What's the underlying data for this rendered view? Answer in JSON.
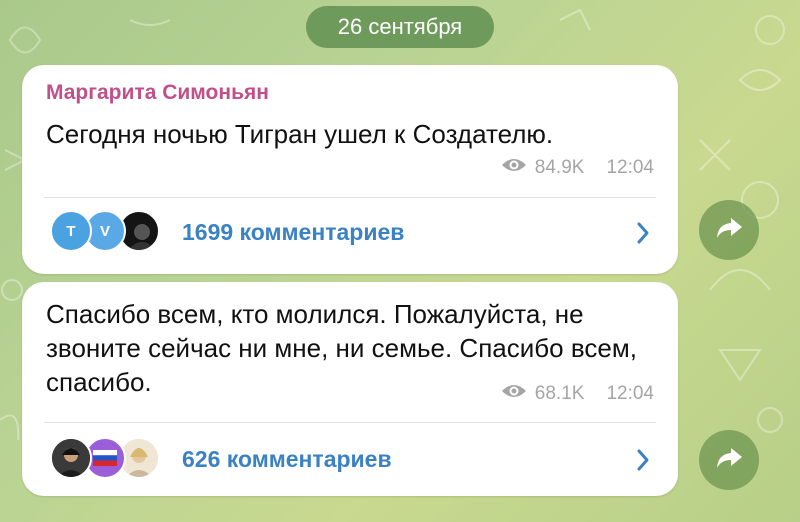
{
  "date_label": "26 сентября",
  "messages": [
    {
      "sender": "Маргарита Симоньян",
      "text": "Сегодня ночью Тигран ушел к Создателю.",
      "views": "84.9K",
      "time": "12:04",
      "comments_label": "1699 комментариев",
      "avatars": [
        "T",
        "V"
      ]
    },
    {
      "text": "Спасибо всем, кто молился. Пожалуйста, не звоните сейчас ни мне, ни семье. Спасибо всем, спасибо.",
      "views": "68.1K",
      "time": "12:04",
      "comments_label": "626 комментариев"
    }
  ],
  "colors": {
    "sender_name": "#c0508a",
    "link": "#3a82c4",
    "date_pill": "#6e9a5b",
    "meta_gray": "#a5a5a5"
  },
  "icons": [
    "eye-icon",
    "chevron-right-icon",
    "share-arrow-icon"
  ]
}
